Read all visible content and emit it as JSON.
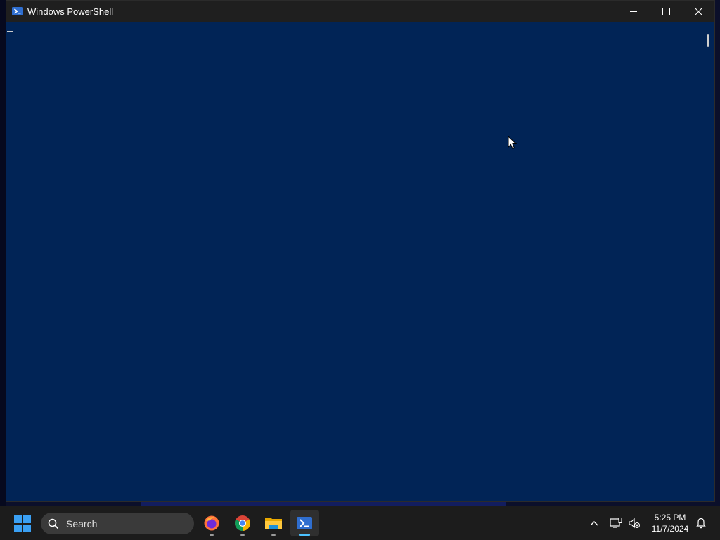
{
  "window": {
    "title": "Windows PowerShell",
    "app_icon": "powershell-icon",
    "controls": [
      "minimize-icon",
      "maximize-icon",
      "close-icon"
    ],
    "background_color": "#012456"
  },
  "taskbar": {
    "search": {
      "label": "Search",
      "icon": "search-icon"
    },
    "apps": [
      {
        "name": "Firefox",
        "icon": "firefox-icon",
        "running": true,
        "active": false
      },
      {
        "name": "Chrome",
        "icon": "chrome-icon",
        "running": true,
        "active": false
      },
      {
        "name": "File Explorer",
        "icon": "folder-icon",
        "running": true,
        "active": false
      },
      {
        "name": "Windows PowerShell",
        "icon": "powershell-icon",
        "running": true,
        "active": true
      }
    ],
    "tray": {
      "icons": [
        "chevron-up-icon",
        "network-icon",
        "volume-muted-icon",
        "bell-icon"
      ],
      "time": "5:25 PM",
      "date": "11/7/2024"
    }
  }
}
